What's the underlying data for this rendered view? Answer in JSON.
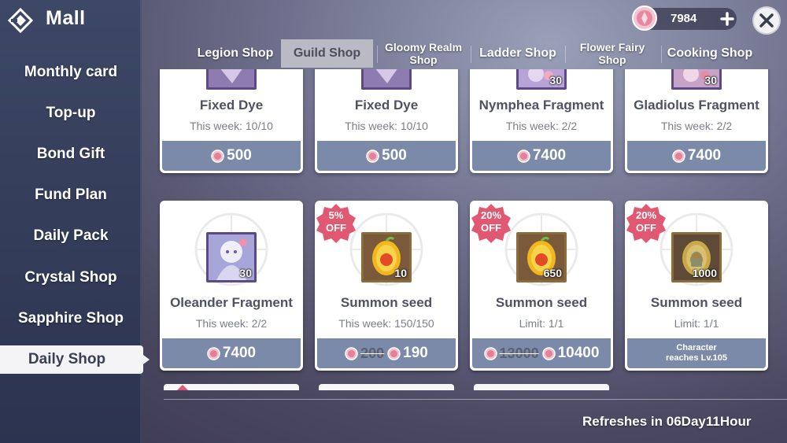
{
  "header": {
    "title": "Mall",
    "back_icon": "back-diamond-icon"
  },
  "currency": {
    "icon": "pink-gem-icon",
    "amount": "7984",
    "add_icon": "plus-icon"
  },
  "close_icon": "close-x-icon",
  "sidebar": {
    "items": [
      {
        "label": "Monthly card",
        "active": false
      },
      {
        "label": "Top-up",
        "active": false
      },
      {
        "label": "Bond Gift",
        "active": false
      },
      {
        "label": "Fund Plan",
        "active": false
      },
      {
        "label": "Daily Pack",
        "active": false
      },
      {
        "label": "Crystal Shop",
        "active": false
      },
      {
        "label": "Sapphire Shop",
        "active": false
      },
      {
        "label": "Daily Shop",
        "active": true
      }
    ]
  },
  "tabs": [
    {
      "label": "Legion Shop",
      "active": false
    },
    {
      "label": "Guild Shop",
      "active": true
    },
    {
      "label": "Gloomy Realm Shop",
      "line1": "Gloomy Realm",
      "line2": "Shop",
      "active": false
    },
    {
      "label": "Ladder Shop",
      "active": false
    },
    {
      "label": "Flower Fairy Shop",
      "line1": "Flower Fairy",
      "line2": "Shop",
      "active": false
    },
    {
      "label": "Cooking Shop",
      "active": false
    }
  ],
  "items": [
    {
      "name": "Fixed Dye",
      "limit": "This week: 10/10",
      "price": "500",
      "icon": "dye-icon",
      "count": "",
      "discount": ""
    },
    {
      "name": "Fixed Dye",
      "limit": "This week: 10/10",
      "price": "500",
      "icon": "dye-icon",
      "count": "",
      "discount": ""
    },
    {
      "name": "Nymphea Fragment",
      "limit": "This week: 2/2",
      "price": "7400",
      "icon": "character-fragment-icon",
      "count": "30",
      "discount": ""
    },
    {
      "name": "Gladiolus Fragment",
      "limit": "This week: 2/2",
      "price": "7400",
      "icon": "character-fragment-icon",
      "count": "30",
      "discount": ""
    },
    {
      "name": "Oleander Fragment",
      "limit": "This week: 2/2",
      "price": "7400",
      "icon": "character-fragment-icon",
      "count": "30",
      "discount": ""
    },
    {
      "name": "Summon seed",
      "limit": "This week: 150/150",
      "price": "190",
      "old_price": "200",
      "icon": "summon-seed-icon",
      "count": "10",
      "discount": "5%",
      "discount_word": "OFF"
    },
    {
      "name": "Summon seed",
      "limit": "Limit: 1/1",
      "price": "10400",
      "old_price": "13000",
      "icon": "summon-seed-icon",
      "count": "650",
      "discount": "20%",
      "discount_word": "OFF"
    },
    {
      "name": "Summon seed",
      "limit": "Limit: 1/1",
      "condition_line1": "Character",
      "condition_line2": "reaches Lv.105",
      "icon": "summon-seed-locked-icon",
      "count": "1000",
      "discount": "20%",
      "discount_word": "OFF"
    }
  ],
  "footer": {
    "refresh_text": "Refreshes in 06Day11Hour"
  },
  "colors": {
    "accent_pink": "#e86a8a",
    "price_bar": "#7b8aa8",
    "sidebar_bg": "#3d4866",
    "active_tab": "#b9bac4"
  }
}
